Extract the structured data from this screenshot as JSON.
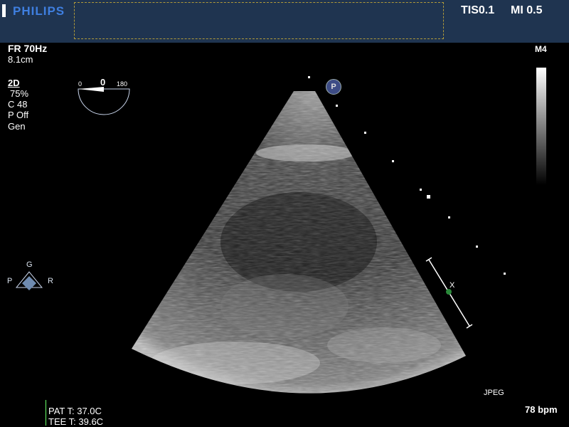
{
  "header": {
    "logo": "PHILIPS",
    "tis": "TIS0.1",
    "mi": "MI 0.5"
  },
  "params": {
    "frame_rate": "FR 70Hz",
    "depth": "8.1cm"
  },
  "mode": {
    "mode": "2D",
    "gain": "75%",
    "compress": "C 48",
    "power": "P Off",
    "freq": "Gen"
  },
  "angle_gauge": {
    "min": "0",
    "current": "0",
    "max": "180"
  },
  "grayscale_map": "M4",
  "probe_marker": "P",
  "orientation": {
    "top": "G",
    "left": "P",
    "right": "R"
  },
  "scale_marker": "X",
  "format": "JPEG",
  "heart_rate": "78 bpm",
  "temps": {
    "patient": "PAT T: 37.0C",
    "tee": "TEE T: 39.6C"
  }
}
